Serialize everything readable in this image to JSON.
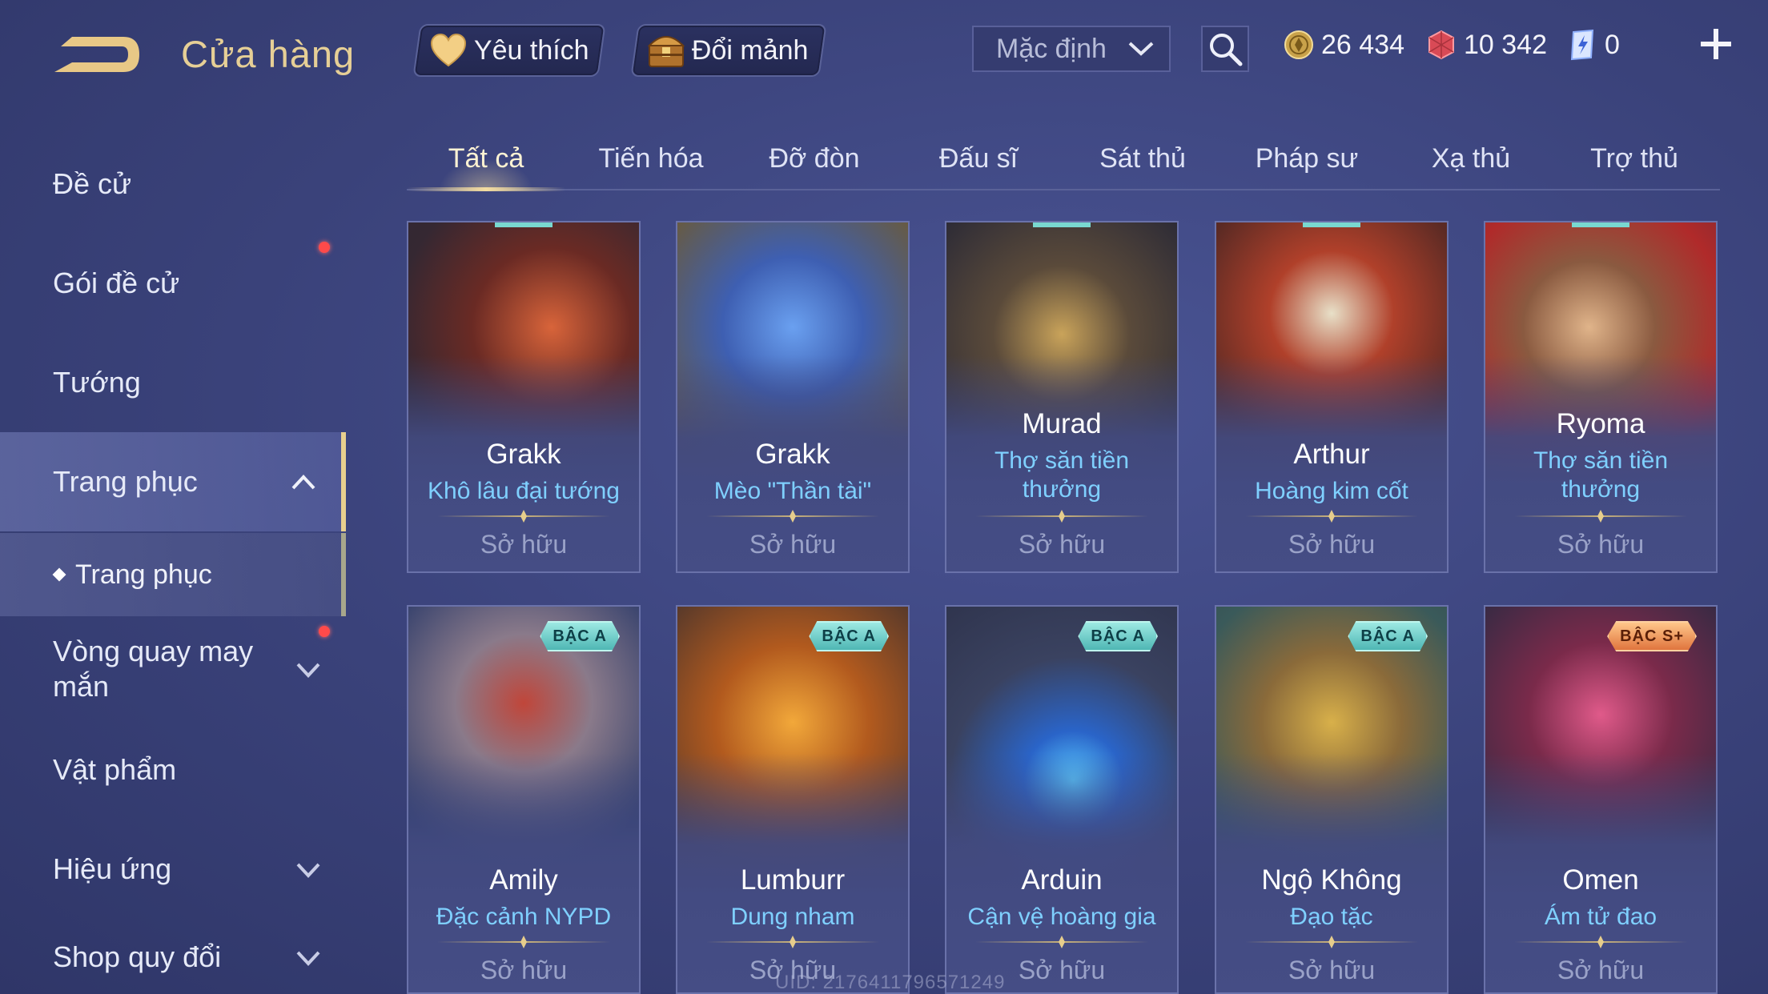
{
  "header": {
    "title": "Cửa hàng",
    "favorites_label": "Yêu thích",
    "shards_label": "Đổi mảnh",
    "sort_value": "Mặc định",
    "currencies": {
      "gold": "26 434",
      "ruby": "10 342",
      "voucher": "0"
    }
  },
  "sidebar": {
    "items": [
      {
        "label": "Đề cử"
      },
      {
        "label": "Gói đề cử"
      },
      {
        "label": "Tướng"
      },
      {
        "label": "Trang phục"
      },
      {
        "label": "Trang phục"
      },
      {
        "label": "Vòng quay may mắn"
      },
      {
        "label": "Vật phẩm"
      },
      {
        "label": "Hiệu ứng"
      },
      {
        "label": "Shop quy đổi"
      }
    ]
  },
  "tabs": [
    "Tất cả",
    "Tiến hóa",
    "Đỡ đòn",
    "Đấu sĩ",
    "Sát thủ",
    "Pháp sư",
    "Xạ thủ",
    "Trợ thủ"
  ],
  "cards": [
    {
      "hero": "Grakk",
      "skin": "Khô lâu đại tướng",
      "status": "Sở hữu",
      "tier": ""
    },
    {
      "hero": "Grakk",
      "skin": "Mèo \"Thần tài\"",
      "status": "Sở hữu",
      "tier": ""
    },
    {
      "hero": "Murad",
      "skin": "Thợ săn tiền thưởng",
      "status": "Sở hữu",
      "tier": ""
    },
    {
      "hero": "Arthur",
      "skin": "Hoàng kim cốt",
      "status": "Sở hữu",
      "tier": ""
    },
    {
      "hero": "Ryoma",
      "skin": "Thợ săn tiền thưởng",
      "status": "Sở hữu",
      "tier": ""
    },
    {
      "hero": "Amily",
      "skin": "Đặc cảnh NYPD",
      "status": "Sở hữu",
      "tier": "BẬC A"
    },
    {
      "hero": "Lumburr",
      "skin": "Dung nham",
      "status": "Sở hữu",
      "tier": "BẬC A"
    },
    {
      "hero": "Arduin",
      "skin": "Cận vệ hoàng gia",
      "status": "Sở hữu",
      "tier": "BẬC A"
    },
    {
      "hero": "Ngộ Không",
      "skin": "Đạo tặc",
      "status": "Sở hữu",
      "tier": "BẬC A"
    },
    {
      "hero": "Omen",
      "skin": "Ám tử đao",
      "status": "Sở hữu",
      "tier": "BẬC S+"
    }
  ],
  "uid": "UID: 2176411796571249",
  "colors": {
    "accent_gold": "#e6cf96",
    "skin_text": "#7fd0ff",
    "tier_a": "#4fb7b4",
    "tier_splus": "#e0753e",
    "notification": "#ff4a4a"
  }
}
